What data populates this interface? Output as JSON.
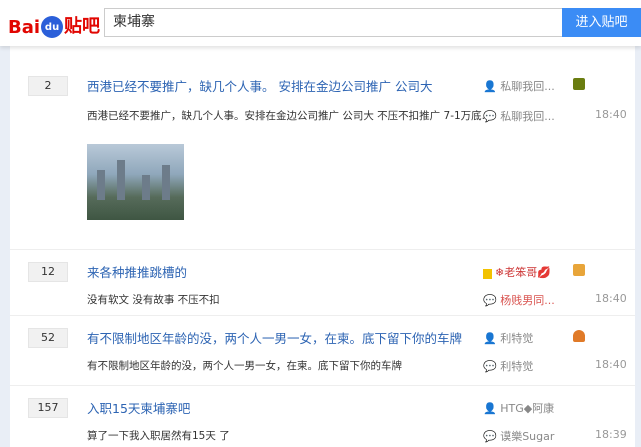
{
  "header": {
    "logo": "Bai du 贴吧",
    "search_value": "柬埔寨",
    "enter_button": "进入贴吧"
  },
  "threads": [
    {
      "replies": "2",
      "title": "西港已经不要推广，缺几个人事。 安排在金边公司推广 公司大",
      "abstract": "西港已经不要推广，缺几个人事。安排在金边公司推广 公司大 不压不扣推广 7-1万底...",
      "author": "私聊我回...",
      "last_reply": "私聊我回...",
      "time": "18:40",
      "badge_color": "#6a7d10"
    },
    {
      "replies": "12",
      "title": "来各种推推跳槽的",
      "abstract": "没有软文 没有故事 不压不扣",
      "author": "老笨哥",
      "last_reply": "杨贱男同...",
      "time": "18:40",
      "badge_color": "#e8a53a"
    },
    {
      "replies": "52",
      "title": "有不限制地区年龄的没，两个人一男一女，在柬。底下留下你的车牌",
      "abstract": "有不限制地区年龄的没，两个人一男一女，在柬。底下留下你的车牌",
      "author": "利特觉",
      "last_reply": "利特觉",
      "time": "18:40",
      "badge_color": "#e07a28"
    },
    {
      "replies": "157",
      "title": "入职15天柬埔寨吧",
      "abstract": "算了一下我入职居然有15天 了",
      "author": "HTG◆阿康",
      "last_reply": "谟樂Sugar",
      "time": "18:39"
    }
  ]
}
